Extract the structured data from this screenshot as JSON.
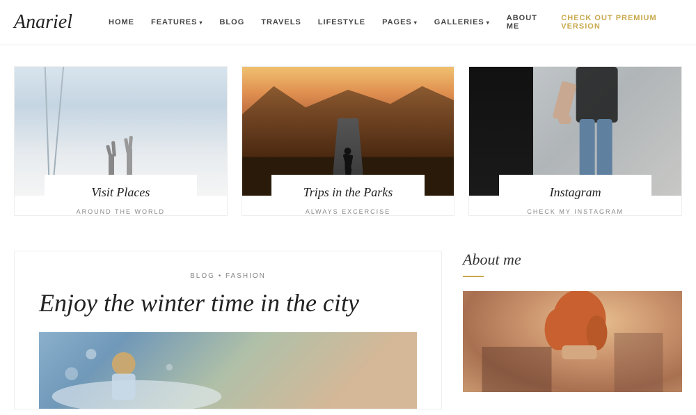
{
  "header": {
    "logo": "Anariel",
    "nav": [
      {
        "label": "HOME",
        "hasDropdown": false
      },
      {
        "label": "FEATURES",
        "hasDropdown": true
      },
      {
        "label": "BLOG",
        "hasDropdown": false
      },
      {
        "label": "TRAVELS",
        "hasDropdown": false
      },
      {
        "label": "LIFESTYLE",
        "hasDropdown": false
      },
      {
        "label": "PAGES",
        "hasDropdown": true
      },
      {
        "label": "GALLERIES",
        "hasDropdown": true
      },
      {
        "label": "ABOUT ME",
        "hasDropdown": false
      },
      {
        "label": "CHECK OUT PREMIUM VERSION",
        "hasDropdown": false,
        "isPremium": true
      }
    ]
  },
  "cards": [
    {
      "title": "Visit Places",
      "subtitle": "AROUND THE WORLD"
    },
    {
      "title": "Trips in the Parks",
      "subtitle": "ALWAYS EXCERCISE"
    },
    {
      "title": "Instagram",
      "subtitle": "CHECK MY INSTAGRAM"
    }
  ],
  "blog": {
    "category": "BLOG • FASHION",
    "title": "Enjoy the winter time in the city"
  },
  "about": {
    "title": "About me",
    "divider_color": "#c9a84c"
  }
}
